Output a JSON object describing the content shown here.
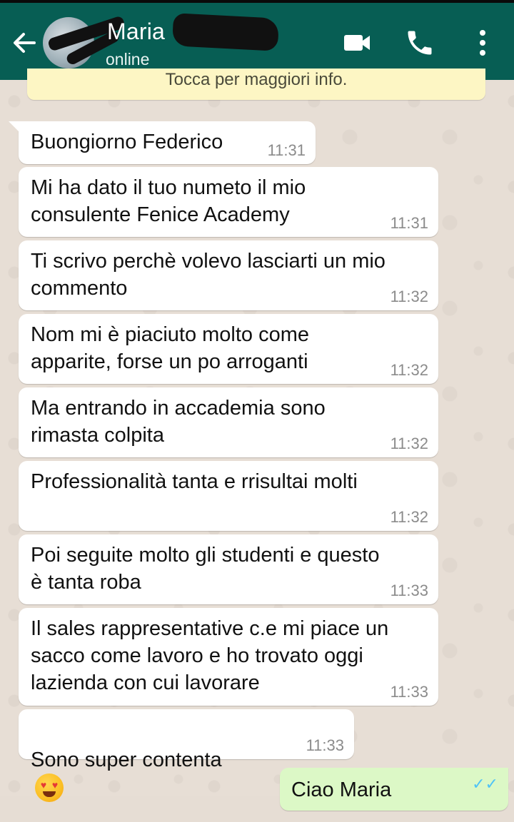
{
  "header": {
    "contact_name": "Maria",
    "status": "online",
    "icons": [
      "back-arrow-icon",
      "video-call-icon",
      "phone-icon",
      "more-vert-icon"
    ],
    "background_color": "#075e54"
  },
  "banner": {
    "text": "Tocca per maggiori info."
  },
  "messages": [
    {
      "text": "Buongiorno Federico",
      "time": "11:31"
    },
    {
      "text": "Mi ha dato il tuo numeto il mio\nconsulente Fenice Academy",
      "time": "11:31"
    },
    {
      "text": "Ti scrivo perchè volevo lasciarti un mio\ncommento",
      "time": "11:32"
    },
    {
      "text": "Nom mi è piaciuto molto come\napparite, forse un po arroganti",
      "time": "11:32"
    },
    {
      "text": "Ma entrando in accademia sono\nrimasta colpita",
      "time": "11:32"
    },
    {
      "text": "Professionalità tanta e rrisultai molti",
      "time": "11:32"
    },
    {
      "text": "Poi seguite molto gli studenti e questo\nè tanta roba",
      "time": "11:33"
    },
    {
      "text": "Il sales rappresentative c.e mi piace un\nsacco come lavoro e ho trovato oggi\nlazienda con cui lavorare",
      "time": "11:33"
    },
    {
      "text": "Sono super contenta",
      "time": "11:33",
      "emoji": "heart-eyes-emoji"
    }
  ],
  "outgoing": {
    "text": "Ciao Maria"
  },
  "colors": {
    "incoming_bubble": "#ffffff",
    "outgoing_bubble": "#dcf8c6",
    "banner": "#fdf6c4"
  }
}
